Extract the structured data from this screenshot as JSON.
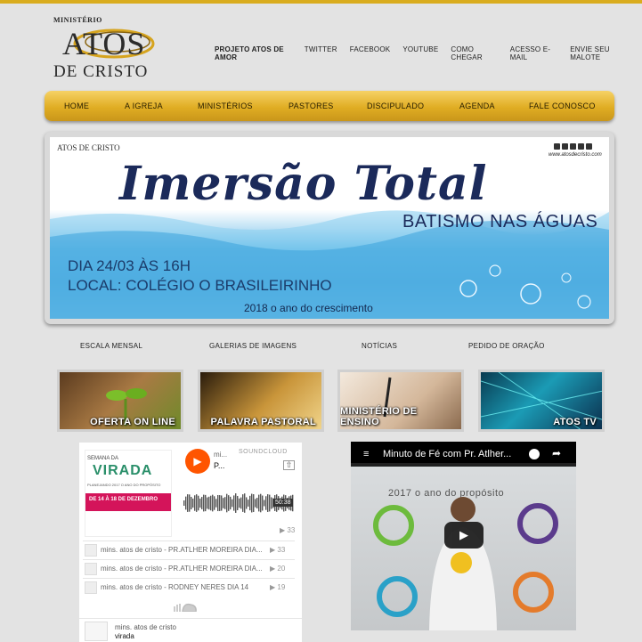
{
  "logo": {
    "ministerio": "MINISTÉRIO",
    "atos": "ATOS",
    "de_cristo": "DE CRISTO"
  },
  "top_links": [
    "PROJETO ATOS DE AMOR",
    "TWITTER",
    "FACEBOOK",
    "YOUTUBE",
    "COMO CHEGAR",
    "ACESSO E-MAIL",
    "ENVIE SEU MALOTE"
  ],
  "nav": [
    "HOME",
    "A IGREJA",
    "MINISTÉRIOS",
    "PASTORES",
    "DISCIPULADO",
    "AGENDA",
    "FALE CONOSCO"
  ],
  "banner": {
    "title": "Imersão Total",
    "subtitle": "BATISMO NAS ÁGUAS",
    "date": "DIA 24/03 ÀS 16H",
    "local": "LOCAL: COLÉGIO O BRASILEIRINHO",
    "year": "2018 o ano do crescimento",
    "url": "www.atosdecristo.com",
    "logo_text": "ATOS DE CRISTO"
  },
  "sections": [
    "ESCALA MENSAL",
    "GALERIAS DE IMAGENS",
    "NOTÍCIAS",
    "PEDIDO DE ORAÇÃO"
  ],
  "thumbs": [
    "OFERTA ON LINE",
    "PALAVRA PASTORAL",
    "MINISTÉRIO DE ENSINO",
    "ATOS TV"
  ],
  "soundcloud": {
    "artist_short": "mi...",
    "track_short": "P...",
    "brand": "SOUNDCLOUD",
    "duration": "50:38",
    "plays": "33",
    "art_text": {
      "line1": "SEMANA DA",
      "line2": "VIRADA",
      "line3": "PLANEJANDO 2017 O ANO DO PROPÓSITO",
      "line4": "DE 14 À 18 DE DEZEMBRO"
    },
    "tracks": [
      {
        "title": "mins. atos de cristo - PR.ATLHER MOREIRA DIA...",
        "plays": "33"
      },
      {
        "title": "mins. atos de cristo - PR.ATLHER MOREIRA DIA...",
        "plays": "20"
      },
      {
        "title": "mins. atos de cristo - RODNEY NERES DIA 14",
        "plays": "19"
      }
    ],
    "footer_artist": "mins. atos de cristo",
    "footer_track": "virada"
  },
  "youtube": {
    "title": "Minuto de Fé com Pr. Atlher...",
    "poster_text": "2017 o ano do propósito"
  },
  "colors": {
    "gold": "#e0ad23",
    "navy": "#1b2a5a",
    "soundcloud": "#ff5500"
  }
}
